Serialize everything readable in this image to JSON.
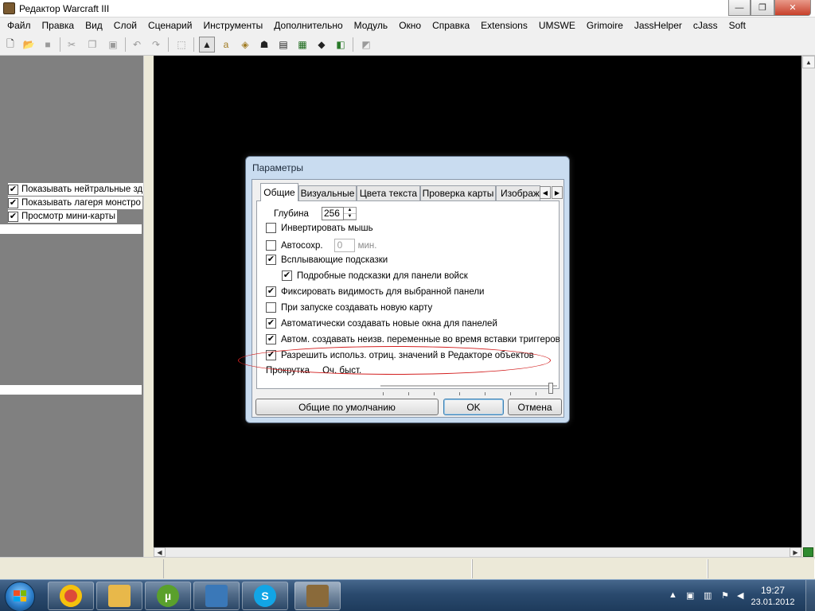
{
  "window": {
    "title": "Редактор Warcraft III",
    "minimize": "—",
    "maximize": "❐",
    "close": "✕"
  },
  "menu": [
    "Файл",
    "Правка",
    "Вид",
    "Слой",
    "Сценарий",
    "Инструменты",
    "Дополнительно",
    "Модуль",
    "Окно",
    "Справка",
    "Extensions",
    "UMSWE",
    "Grimoire",
    "JassHelper",
    "cJass",
    "Soft"
  ],
  "toolbar": {
    "icons": [
      "new-file-icon",
      "open-folder-icon",
      "save-icon",
      "cut-icon",
      "copy-icon",
      "paste-icon",
      "undo-icon",
      "redo-icon",
      "select-icon",
      "terrain-palette-icon",
      "doodad-palette-icon",
      "sound-editor-icon",
      "unit-palette-icon",
      "object-editor-icon",
      "trigger-editor-icon",
      "import-manager-icon",
      "test-map-icon",
      "camera-icon"
    ]
  },
  "left_panel": {
    "items": [
      {
        "label": "Показывать нейтральные зд",
        "checked": true
      },
      {
        "label": "Показывать лагеря монстро",
        "checked": true
      },
      {
        "label": "Просмотр мини-карты",
        "checked": true
      }
    ]
  },
  "dialog": {
    "title": "Параметры",
    "tabs": [
      "Общие",
      "Визуальные",
      "Цвета текста",
      "Проверка карты",
      "Изображ"
    ],
    "active_tab": "Общие",
    "depth": {
      "label": "Глубина",
      "value": "256"
    },
    "invert_mouse": {
      "label": "Инвертировать мышь",
      "checked": false
    },
    "autosave": {
      "label": "Автосохр.",
      "checked": false,
      "value": "0",
      "unit": "мин."
    },
    "options": [
      {
        "label": "Всплывающие подсказки",
        "checked": true
      },
      {
        "label": "Подробные подсказки для панели войск",
        "checked": true
      },
      {
        "label": "Фиксировать видимость для выбранной панели",
        "checked": true
      },
      {
        "label": "При запуске создавать новую карту",
        "checked": false
      },
      {
        "label": "Автоматически создавать новые окна для панелей",
        "checked": true
      },
      {
        "label": "Автом. создавать неизв. переменные во время вставки триггеров",
        "checked": true
      },
      {
        "label": "Разрешить использ. отриц. значений в Редакторе объектов",
        "checked": true
      }
    ],
    "scroll": {
      "label": "Прокрутка",
      "value_label": "Оч. быст.",
      "level": 1.0
    },
    "buttons": {
      "defaults": "Общие по умолчанию",
      "ok": "OK",
      "cancel": "Отмена"
    },
    "highlight_color": "#d32020"
  },
  "taskbar": {
    "apps": [
      {
        "name": "chrome-icon",
        "color": "#dd4b39"
      },
      {
        "name": "explorer-icon",
        "color": "#e8b84a"
      },
      {
        "name": "utorrent-icon",
        "color": "#5aa02c"
      },
      {
        "name": "monitor-icon",
        "color": "#3a78b8"
      },
      {
        "name": "skype-icon",
        "color": "#12a5e6"
      },
      {
        "name": "warcraft-editor-icon",
        "color": "#8a6a3a"
      }
    ],
    "clock": {
      "time": "19:27",
      "date": "23.01.2012"
    }
  }
}
